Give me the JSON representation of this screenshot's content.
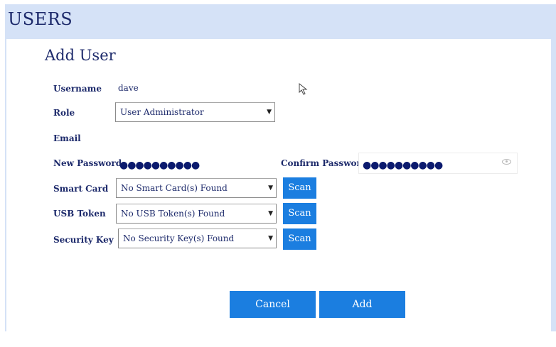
{
  "header": {
    "title": "USERS"
  },
  "form": {
    "title": "Add User",
    "username": {
      "label": "Username",
      "value": "dave"
    },
    "role": {
      "label": "Role",
      "value": "User Administrator"
    },
    "email": {
      "label": "Email"
    },
    "new_password": {
      "label": "New Password",
      "masked": "●●●●●●●●●●"
    },
    "confirm_password": {
      "label": "Confirm Password",
      "masked": "●●●●●●●●●●"
    },
    "smart_card": {
      "label": "Smart Card",
      "value": "No Smart Card(s) Found",
      "scan_label": "Scan"
    },
    "usb_token": {
      "label": "USB Token",
      "value": "No USB Token(s) Found",
      "scan_label": "Scan"
    },
    "security_key": {
      "label": "Security Key",
      "value": "No Security Key(s) Found",
      "scan_label": "Scan"
    }
  },
  "actions": {
    "cancel_label": "Cancel",
    "add_label": "Add"
  },
  "colors": {
    "accent": "#1b7ee0",
    "header_bg": "#d5e2f7",
    "text": "#1d2a6b"
  },
  "icons": {
    "dropdown": "chevron-down-icon",
    "reveal": "eye-icon",
    "pointer": "mouse-cursor-icon"
  }
}
